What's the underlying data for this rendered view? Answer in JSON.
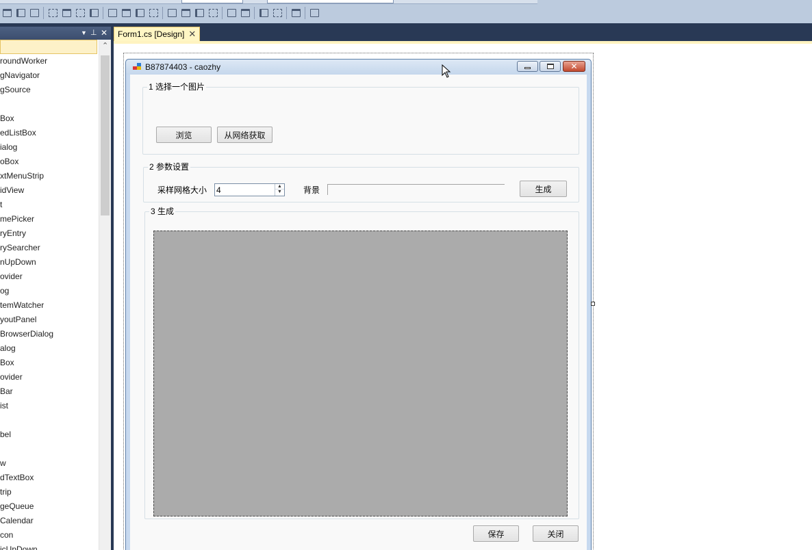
{
  "toolbox": {
    "items": [
      "roundWorker",
      "gNavigator",
      "gSource",
      "",
      "Box",
      "edListBox",
      "ialog",
      "oBox",
      "xtMenuStrip",
      "idView",
      "t",
      "mePicker",
      "ryEntry",
      "rySearcher",
      "nUpDown",
      "ovider",
      "og",
      "temWatcher",
      "youtPanel",
      "BrowserDialog",
      "alog",
      "Box",
      "ovider",
      "Bar",
      "ist",
      "",
      "bel",
      "",
      "w",
      "dTextBox",
      "trip",
      "geQueue",
      "Calendar",
      "con",
      "icUpDown"
    ],
    "pin_icon": "pin-icon",
    "dropdown_icon": "chevron-down-icon",
    "close_icon": "close-icon"
  },
  "tab": {
    "label": "Form1.cs [Design]",
    "close_glyph": "✕"
  },
  "form": {
    "title": "B87874403 - caozhy",
    "group1": {
      "legend": "1 选择一个图片",
      "browse": "浏览",
      "fetch": "从网络获取"
    },
    "group2": {
      "legend": "2 参数设置",
      "grid_label": "采样网格大小",
      "grid_value": "4",
      "bg_label": "背景",
      "generate": "生成"
    },
    "group3": {
      "legend": "3 生成"
    },
    "save": "保存",
    "close": "关闭"
  },
  "colors": {
    "ide_background": "#293955",
    "toolbar": "#bccbde",
    "active_tab": "#fff6c4",
    "picturebox": "#ababab",
    "close_button": "#c24a2f"
  }
}
